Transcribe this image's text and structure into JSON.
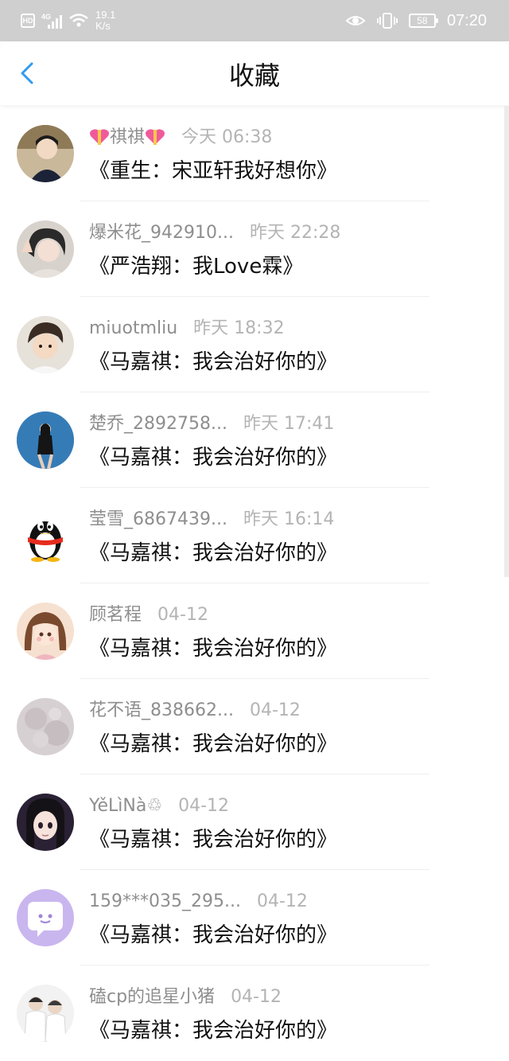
{
  "status_bar": {
    "hd": "HD",
    "network": "4G",
    "speed_value": "19.1",
    "speed_unit": "K/s",
    "battery": "58",
    "time": "07:20"
  },
  "header": {
    "title": "收藏"
  },
  "items": [
    {
      "name": "祺祺",
      "time": "今天 06:38",
      "title": "《重生：宋亚轩我好想你》"
    },
    {
      "name": "爆米花_942910...",
      "time": "昨天 22:28",
      "title": "《严浩翔：我Love霖》"
    },
    {
      "name": "miuotmliu",
      "time": "昨天 18:32",
      "title": "《马嘉祺：我会治好你的》"
    },
    {
      "name": "楚乔_2892758...",
      "time": "昨天 17:41",
      "title": "《马嘉祺：我会治好你的》"
    },
    {
      "name": "莹雪_6867439...",
      "time": "昨天 16:14",
      "title": "《马嘉祺：我会治好你的》"
    },
    {
      "name": "顾茗程",
      "time": "04-12",
      "title": "《马嘉祺：我会治好你的》"
    },
    {
      "name": "花不语_838662...",
      "time": "04-12",
      "title": "《马嘉祺：我会治好你的》"
    },
    {
      "name": "YěLìNà♲",
      "time": "04-12",
      "title": "《马嘉祺：我会治好你的》"
    },
    {
      "name": "159***035_295...",
      "time": "04-12",
      "title": "《马嘉祺：我会治好你的》"
    },
    {
      "name": "磕cp的追星小猪",
      "time": "04-12",
      "title": "《马嘉祺：我会治好你的》"
    }
  ],
  "colors": {
    "accent": "#2f9bf0",
    "status_bar_bg": "#cfcfcf",
    "meta_text": "#8e8e8e",
    "time_text": "#b4b4b4"
  }
}
